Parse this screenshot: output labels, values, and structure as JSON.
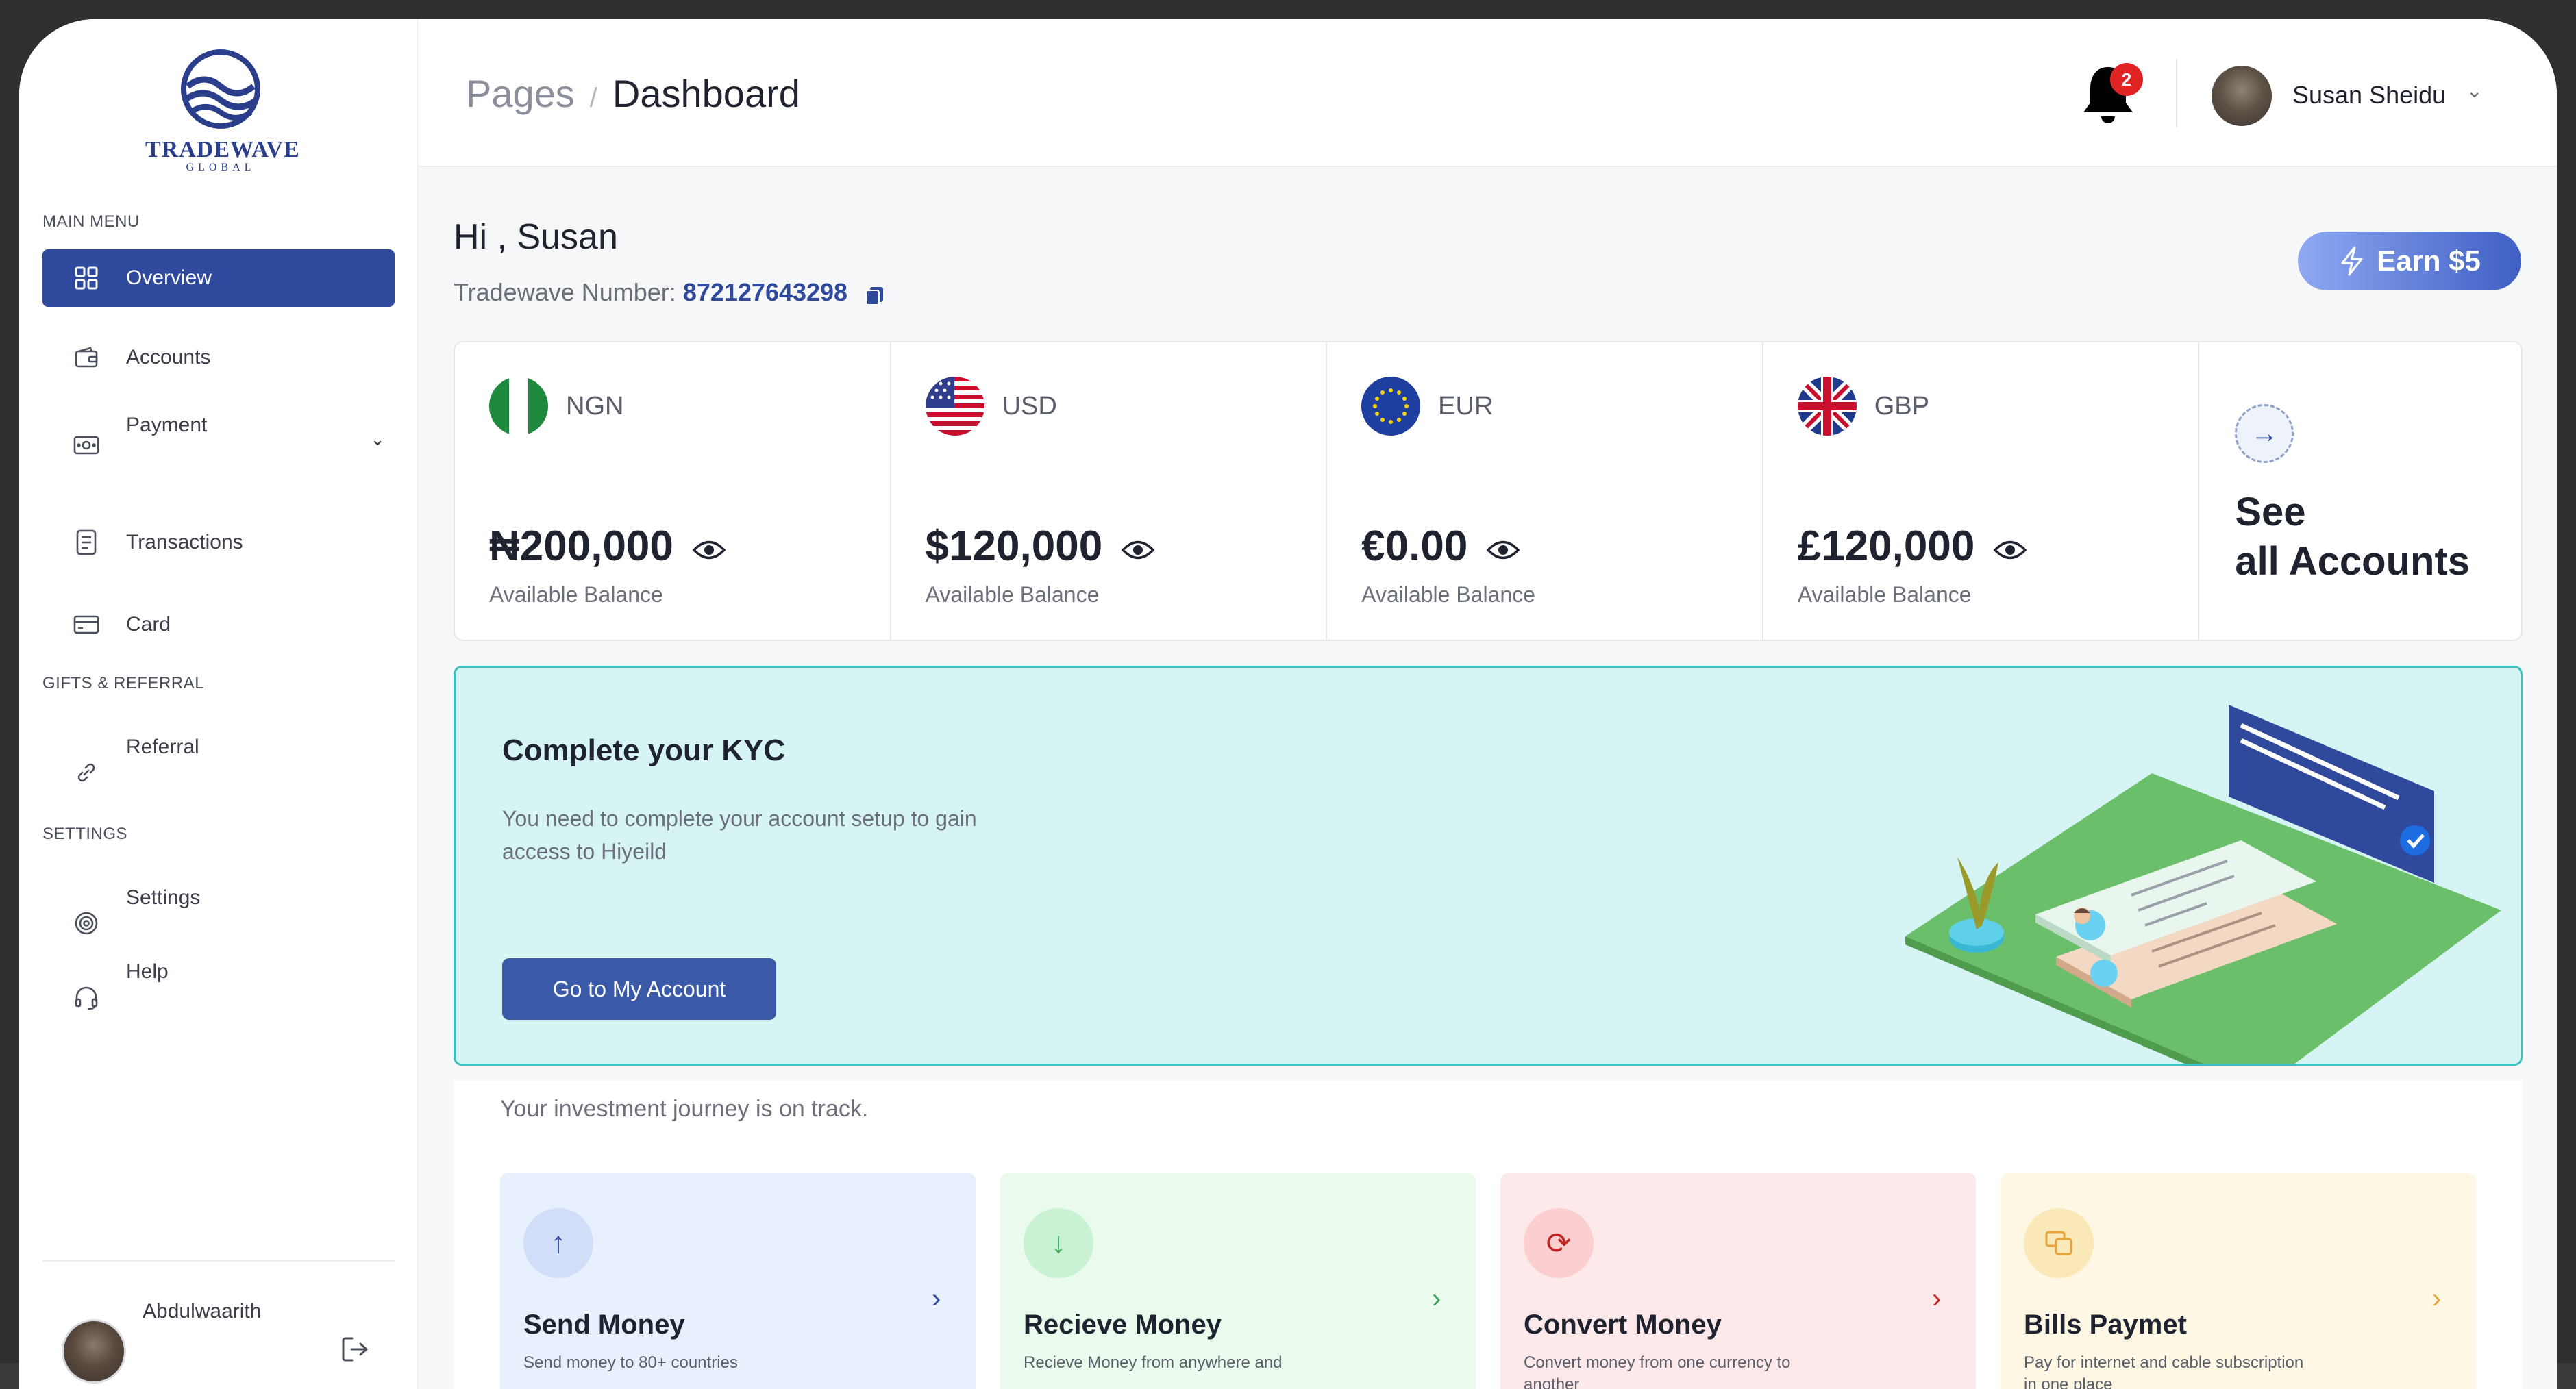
{
  "brand": {
    "name": "TRADEWAVE",
    "sub": "GLOBAL"
  },
  "sidebar": {
    "main_menu_label": "MAIN MENU",
    "items": [
      {
        "label": "Overview"
      },
      {
        "label": "Accounts"
      },
      {
        "label": "Payment"
      },
      {
        "label": "Transactions"
      },
      {
        "label": "Card"
      }
    ],
    "gifts_label": "GIFTS & REFERRAL",
    "referral_label": "Referral",
    "settings_label": "SETTINGS",
    "settings_items": [
      {
        "label": "Settings"
      },
      {
        "label": "Help"
      }
    ],
    "user_name": "Abdulwaarith"
  },
  "header": {
    "breadcrumb_root": "Pages",
    "breadcrumb_sep": "/",
    "breadcrumb_current": "Dashboard",
    "notification_count": "2",
    "user_name": "Susan Sheidu"
  },
  "main": {
    "greeting": "Hi , Susan",
    "tradewave_label": "Tradewave Number:",
    "tradewave_number": "872127643298",
    "earn_label": "Earn $5",
    "accounts": [
      {
        "code": "NGN",
        "amount": "₦200,000",
        "caption": "Available Balance"
      },
      {
        "code": "USD",
        "amount": "$120,000",
        "caption": "Available Balance"
      },
      {
        "code": "EUR",
        "amount": "€0.00",
        "caption": "Available Balance"
      },
      {
        "code": "GBP",
        "amount": "£120,000",
        "caption": "Available Balance"
      }
    ],
    "see_all_line1": "See",
    "see_all_line2": "all Accounts",
    "kyc": {
      "title": "Complete your KYC",
      "description": "You need to complete your account setup to gain access to Hiyeild",
      "button": "Go to My Account"
    },
    "investment_text": "Your investment journey is on track.",
    "quick_actions": [
      {
        "title": "Send Money",
        "desc": "Send money to 80+ countries",
        "bg": "#e8f0fd",
        "accent": "#2f4a9c"
      },
      {
        "title": "Recieve Money",
        "desc": "Recieve Money from anywhere and",
        "bg": "#eafbee",
        "accent": "#3aa55a"
      },
      {
        "title": "Convert Money",
        "desc": "Convert money from one currency to another",
        "bg": "#fde9e9",
        "accent": "#c02626"
      },
      {
        "title": "Bills Paymet",
        "desc": "Pay for internet and cable subscription in one place",
        "bg": "#fdf7e4",
        "accent": "#e6a23c"
      }
    ]
  },
  "colors": {
    "primary": "#2f4a9c",
    "kyc_bg": "#d6f4f4",
    "kyc_border": "#3cc0c0",
    "badge": "#e02424"
  }
}
